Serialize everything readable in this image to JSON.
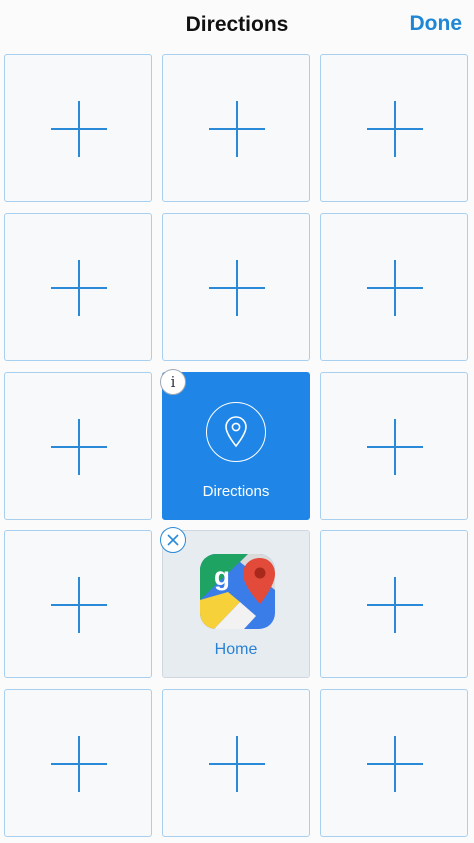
{
  "header": {
    "title": "Directions",
    "done_label": "Done"
  },
  "tiles": {
    "directions": {
      "label": "Directions",
      "icon": "location-pin-icon",
      "color": "#1f86e8"
    },
    "home": {
      "label": "Home",
      "icon": "google-maps-app-icon"
    }
  },
  "badges": {
    "info": "i",
    "close": "close-icon"
  },
  "colors": {
    "accent": "#1f86d6",
    "tile_border": "#a8d0ee",
    "plus": "#2a8ad8"
  }
}
